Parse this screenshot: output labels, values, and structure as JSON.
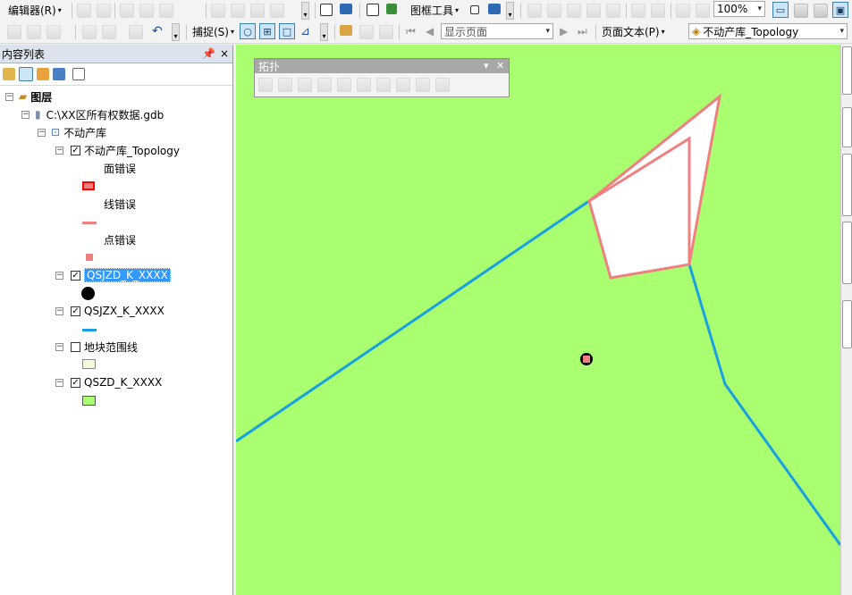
{
  "toolbar1": {
    "editor_label": "编辑器(R)",
    "layout_tools_label": "图框工具",
    "zoom_value": "100%"
  },
  "toolbar2": {
    "snapping_label": "捕捉(S)",
    "page_display": "显示页面",
    "page_text_label": "页面文本(P)",
    "topology_combo": "不动产库_Topology"
  },
  "toc": {
    "title": "内容列表",
    "pin": " ",
    "close": "×",
    "layers_root": "图层",
    "gdb": "C:\\XX区所有权数据.gdb",
    "dataset": "不动产库",
    "topology": {
      "name": "不动产库_Topology",
      "legend": [
        {
          "label": "面错误",
          "color": "#ff0000"
        },
        {
          "label": "线错误",
          "color": "#f08080"
        },
        {
          "label": "点错误",
          "color": "#f08080"
        }
      ]
    },
    "layers": [
      {
        "name": "QSJZD_K_XXXX",
        "checked": true,
        "selected": true
      },
      {
        "name": "QSJZX_K_XXXX",
        "checked": true,
        "selected": false
      },
      {
        "name": "地块范围线",
        "checked": false,
        "selected": false
      },
      {
        "name": "QSZD_K_XXXX",
        "checked": true,
        "selected": false
      }
    ]
  },
  "topology_toolbar": {
    "title": "拓扑"
  },
  "colors": {
    "map_background": "#a9ff70",
    "line_blue": "#19a0e0",
    "error_pink": "#f08080",
    "selection_blue": "#3399ff"
  }
}
